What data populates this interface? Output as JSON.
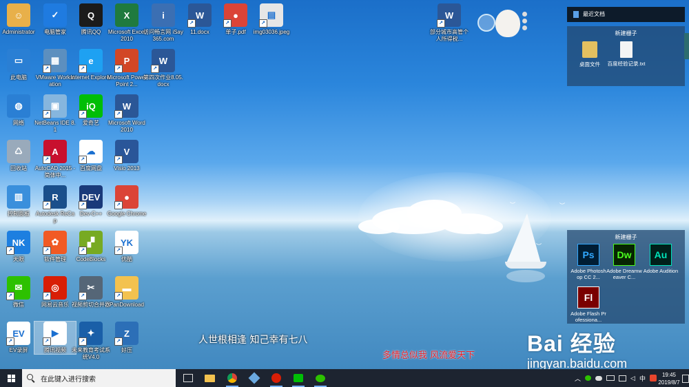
{
  "desktop_icons": [
    {
      "label": "Administrator",
      "icon": "user-folder-icon",
      "color": "#e8b04a"
    },
    {
      "label": "电脑管家",
      "icon": "shield-icon",
      "color": "#1f7be0"
    },
    {
      "label": "腾讯QQ",
      "icon": "qq-penguin-icon",
      "color": "#1b1b1b"
    },
    {
      "label": "Microsoft Excel 2010",
      "icon": "excel-icon",
      "color": "#1f7a3e"
    },
    {
      "label": "访问畅言网 iSay365.com",
      "icon": "isay-icon",
      "color": "#3b6fb3"
    },
    {
      "label": "11.docx",
      "icon": "word-doc-icon",
      "color": "#2b5797"
    },
    {
      "label": "单子.pdf",
      "icon": "chrome-icon",
      "color": "#db4437"
    },
    {
      "label": "img03036.jpeg",
      "icon": "image-file-icon",
      "color": "#e6e6e6"
    },
    {
      "label": "部分城市高管个人所得税...",
      "icon": "word-doc-icon",
      "color": "#2b5797"
    },
    {
      "label": "此电脑",
      "icon": "computer-icon",
      "color": "#2a7fd4"
    },
    {
      "label": "VMware Workstation",
      "icon": "vmware-icon",
      "color": "#5c8fbf"
    },
    {
      "label": "Internet Explorer",
      "icon": "ie-icon",
      "color": "#1ea1f2"
    },
    {
      "label": "Microsoft PowerPoint 2...",
      "icon": "powerpoint-icon",
      "color": "#d24726"
    },
    {
      "label": "第四次作业8.05.docx",
      "icon": "word-doc-icon",
      "color": "#2b5797"
    },
    {
      "label": "网络",
      "icon": "network-icon",
      "color": "#2a7fd4"
    },
    {
      "label": "NetBeans IDE 8.1",
      "icon": "netbeans-icon",
      "color": "#86b6de"
    },
    {
      "label": "爱奇艺",
      "icon": "iqiyi-icon",
      "color": "#00be06"
    },
    {
      "label": "Microsoft Word 2010",
      "icon": "word-icon",
      "color": "#2b5797"
    },
    {
      "label": "回收站",
      "icon": "recycle-bin-icon",
      "color": "#9ab"
    },
    {
      "label": "AutoCAD 2015 - 简体中...",
      "icon": "autocad-icon",
      "color": "#c8102e"
    },
    {
      "label": "百度网盘",
      "icon": "baidu-netdisk-icon",
      "color": "#ffffff"
    },
    {
      "label": "Visio 2013",
      "icon": "visio-icon",
      "color": "#2a5699"
    },
    {
      "label": "控制面板",
      "icon": "control-panel-icon",
      "color": "#3a8fdc"
    },
    {
      "label": "Autodesk ReCap",
      "icon": "recap-icon",
      "color": "#1a4f8b"
    },
    {
      "label": "Dev-C++",
      "icon": "devcpp-icon",
      "color": "#1a3a7a"
    },
    {
      "label": "Google Chrome",
      "icon": "chrome-icon",
      "color": "#db4437"
    },
    {
      "label": "天眼",
      "icon": "nk-icon",
      "color": "#1d7fe0"
    },
    {
      "label": "软件管理",
      "icon": "software-manager-icon",
      "color": "#f15a24"
    },
    {
      "label": "CodeBlocks",
      "icon": "codeblocks-icon",
      "color": "#7a2"
    },
    {
      "label": "优酷",
      "icon": "youku-icon",
      "color": "#ffffff"
    },
    {
      "label": "微信",
      "icon": "wechat-icon",
      "color": "#2dc100"
    },
    {
      "label": "网易云音乐",
      "icon": "netease-music-icon",
      "color": "#d81e06"
    },
    {
      "label": "视频剪切合并器",
      "icon": "scissors-icon",
      "color": "#567"
    },
    {
      "label": "PanDownload",
      "icon": "folder-icon",
      "color": "#f3c24f"
    },
    {
      "label": "EV录屏",
      "icon": "ev-recorder-icon",
      "color": "#ffffff"
    },
    {
      "label": "腾讯视频",
      "icon": "tencent-video-icon",
      "color": "#ffffff"
    },
    {
      "label": "未来教育考试系统V4.0",
      "icon": "exam-system-icon",
      "color": "#1a5fa8"
    },
    {
      "label": "好压",
      "icon": "haozip-icon",
      "color": "#2c6fb7"
    }
  ],
  "recent_docs": {
    "title": "最近文档"
  },
  "fence_top": {
    "title": "新建栅子",
    "items": [
      {
        "label": "桌面文件",
        "icon": "folder-icon"
      },
      {
        "label": "百度经验记录.txt",
        "icon": "text-file-icon"
      }
    ]
  },
  "fence_bottom": {
    "title": "新建栅子",
    "items": [
      {
        "label": "Adobe Photoshop CC 2...",
        "icon": "photoshop-icon",
        "abbr": "Ps"
      },
      {
        "label": "Adobe Dreamweaver C...",
        "icon": "dreamweaver-icon",
        "abbr": "Dw"
      },
      {
        "label": "Adobe Audition",
        "icon": "audition-icon",
        "abbr": "Au"
      },
      {
        "label": "Adobe Flash Professiona...",
        "icon": "flash-icon",
        "abbr": "Fl"
      }
    ]
  },
  "subtitles": {
    "left": "人世根相逢 知己幸有七八",
    "right": "多情总似我 风流爱天下"
  },
  "watermark": {
    "big": "Bai  经验",
    "small": "jingyan.baidu.com"
  },
  "taskbar": {
    "search_placeholder": "在此键入进行搜索",
    "apps": [
      "task-view-icon",
      "file-explorer-icon",
      "chrome-icon",
      "app-box-icon",
      "netease-music-icon",
      "iqiyi-icon",
      "wechat-icon"
    ]
  },
  "tray": {
    "ime": "中",
    "time": "19:45",
    "date": "2019/8/7"
  }
}
